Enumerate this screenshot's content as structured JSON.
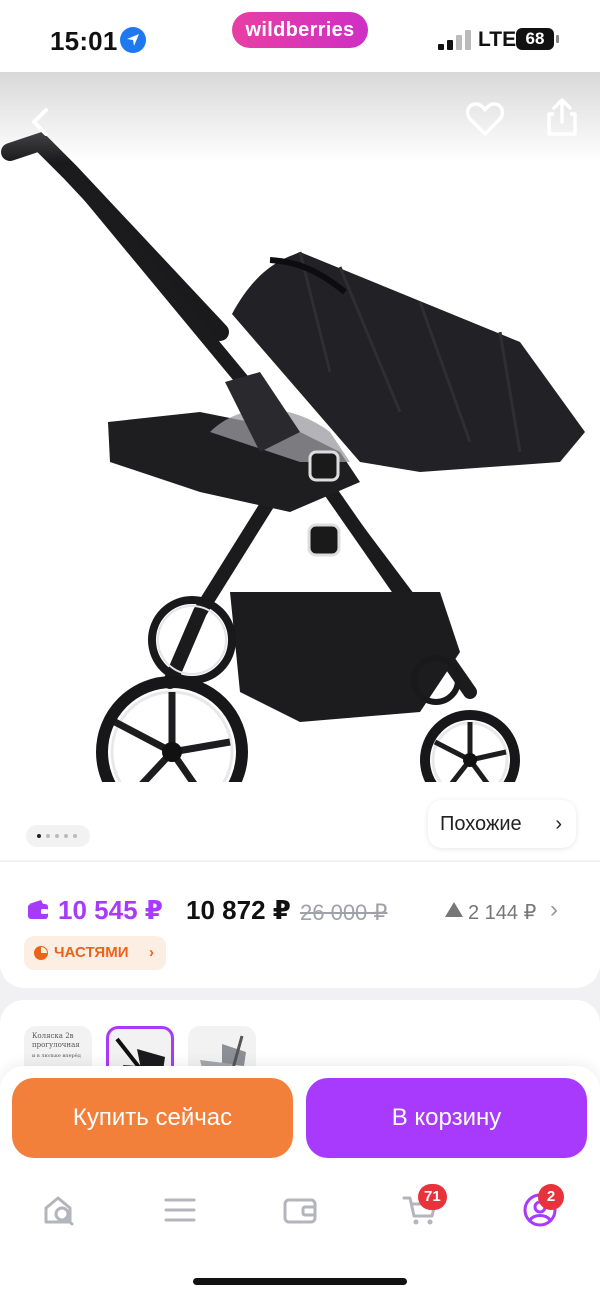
{
  "status_bar": {
    "time": "15:01",
    "app_badge": "wildberries",
    "network": "LTE",
    "battery": "68"
  },
  "product": {
    "image_icon": "stroller-image",
    "gallery_count": 5,
    "gallery_active_index": 0,
    "similar_label": "Похожие"
  },
  "price": {
    "wallet_price": "10 545 ₽",
    "price": "10 872 ₽",
    "old_price": "26 000 ₽",
    "delta": "2 144 ₽",
    "installments_label": "ЧАСТЯМИ"
  },
  "thumbnails": {
    "first_caption": "Коляска 2в прогулочная",
    "first_subcaption": "и в люльке вперёд"
  },
  "actions": {
    "buy_now": "Купить сейчас",
    "add_to_cart": "В корзину"
  },
  "tabbar": {
    "cart_badge": "71",
    "profile_badge": "2"
  },
  "colors": {
    "accent": "#a73afd",
    "buy": "#f2803a",
    "badge": "#e8323c",
    "installments": "#e8641b"
  }
}
